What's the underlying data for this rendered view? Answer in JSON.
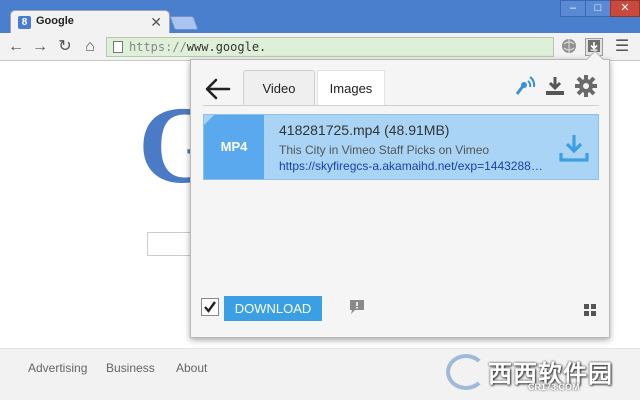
{
  "browser": {
    "tab_title": "Google",
    "tab_favicon": "8",
    "tab_close": "✕",
    "url_scheme": "https://",
    "url_host": "www.google.",
    "window_controls": {
      "minimize": "–",
      "maximize": "□",
      "close": "✕"
    }
  },
  "toolbar": {
    "back": "←",
    "forward": "→",
    "reload": "↻",
    "home": "⌂",
    "menu": "☰"
  },
  "page": {
    "logo_letter": "G",
    "footer_links": [
      "Advertising",
      "Business",
      "About"
    ],
    "watermark_main": "西西软件园",
    "watermark_sub": "CR173.COM"
  },
  "popup": {
    "tabs": [
      "Video",
      "Images"
    ],
    "active_tab": "Video",
    "items": [
      {
        "badge": "MP4",
        "title": "418281725.mp4 (48.91MB)",
        "subtitle": "This City in Vimeo Staff Picks on Vimeo",
        "url": "https://skyfiregcs-a.akamaihd.net/exp=14432887…"
      }
    ],
    "checkbox_checked": true,
    "download_label": "DOWNLOAD"
  },
  "colors": {
    "accent": "#3b9fe4",
    "item_bg": "#a9d4f6",
    "badge_bg": "#5aa9ee",
    "titlebar": "#4a7fce"
  }
}
